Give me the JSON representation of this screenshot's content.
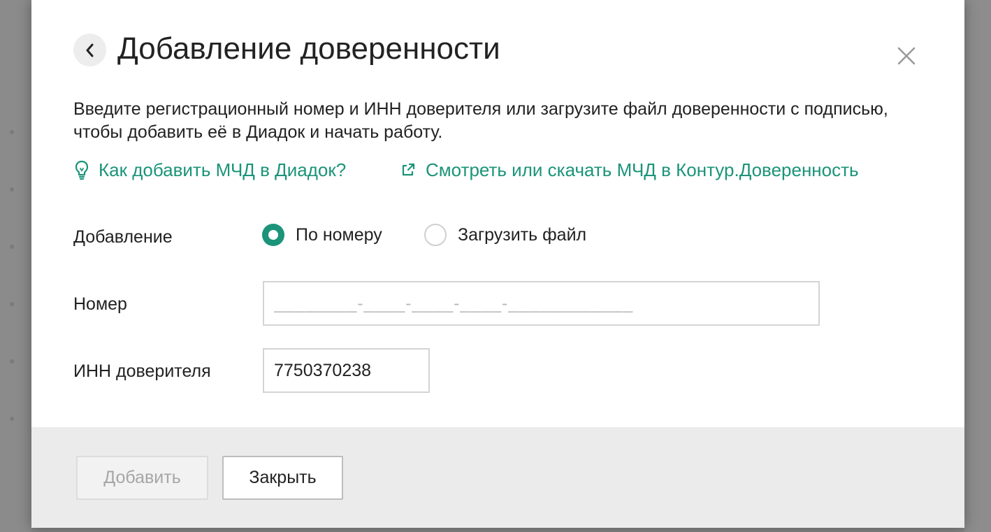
{
  "modal": {
    "title": "Добавление доверенности",
    "description": "Введите регистрационный номер и ИНН доверителя или загрузите файл доверенности с подписью, чтобы добавить её в Диадок и начать работу.",
    "links": [
      {
        "label": "Как добавить МЧД в Диадок?",
        "icon": "lightbulb-icon"
      },
      {
        "label": "Смотреть или скачать МЧД в Контур.Доверенность",
        "icon": "external-link-icon"
      }
    ],
    "colors": {
      "accent": "#1b9479",
      "text": "#222222",
      "footer_bg": "#ebebeb"
    }
  },
  "form": {
    "mode_label": "Добавление",
    "mode_options": [
      {
        "label": "По номеру",
        "selected": true
      },
      {
        "label": "Загрузить файл",
        "selected": false
      }
    ],
    "number_label": "Номер",
    "number_placeholder": "________-____-____-____-____________",
    "number_value": "",
    "inn_label": "ИНН доверителя",
    "inn_value": "7750370238"
  },
  "footer": {
    "add_label": "Добавить",
    "close_label": "Закрыть"
  }
}
